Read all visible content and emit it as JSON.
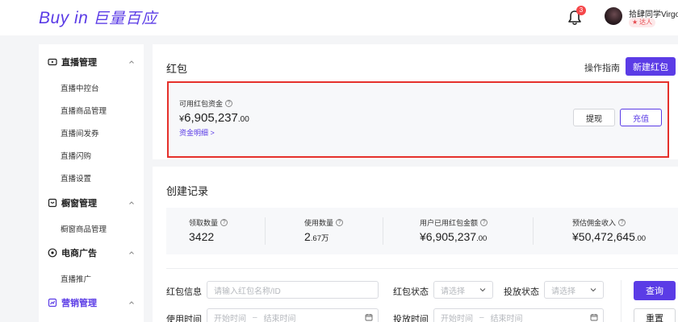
{
  "header": {
    "logo_en": "Buy in",
    "logo_cn": "巨量百应",
    "notification_count": "3",
    "user_name": "拾肆同学Virgo",
    "user_tag": "达人"
  },
  "sidebar": {
    "sections": [
      {
        "label": "直播管理",
        "items": [
          "直播中控台",
          "直播商品管理",
          "直播间发券",
          "直播闪购",
          "直播设置"
        ]
      },
      {
        "label": "橱窗管理",
        "items": [
          "橱窗商品管理"
        ]
      },
      {
        "label": "电商广告",
        "items": [
          "直播推广"
        ]
      },
      {
        "label": "营销管理",
        "items": []
      }
    ]
  },
  "red_packet": {
    "title": "红包",
    "guide_label": "操作指南",
    "create_label": "新建红包",
    "fund_label": "可用红包资金",
    "fund_currency": "¥",
    "fund_int": "6,905,237",
    "fund_dec": ".00",
    "fund_detail_label": "资金明细 >",
    "withdraw_label": "提现",
    "recharge_label": "充值"
  },
  "records": {
    "title": "创建记录",
    "stats": [
      {
        "label": "领取数量",
        "value_main": "3422",
        "value_small": ""
      },
      {
        "label": "使用数量",
        "value_main": "2",
        "value_small": ".67万"
      },
      {
        "label": "用户已用红包金额",
        "value_main": "¥6,905,237",
        "value_small": ".00"
      },
      {
        "label": "预估佣金收入",
        "value_main": "¥50,472,645",
        "value_small": ".00"
      }
    ],
    "filters": {
      "name_label": "红包信息",
      "name_placeholder": "请输入红包名称/ID",
      "status_label": "红包状态",
      "status_placeholder": "请选择",
      "release_label": "投放状态",
      "release_placeholder": "请选择",
      "use_time_label": "使用时间",
      "release_time_label": "投放时间",
      "start_placeholder": "开始时间",
      "end_placeholder": "结束时间",
      "range_sep": "–",
      "query_label": "查询",
      "reset_label": "重置"
    }
  },
  "colors": {
    "brand": "#5b3ce6",
    "highlight_border": "#e5302b",
    "badge": "#f5474a"
  }
}
